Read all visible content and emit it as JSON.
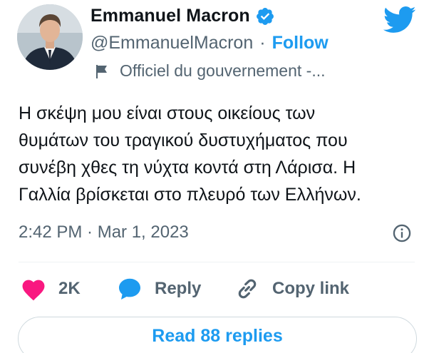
{
  "author": {
    "display_name": "Emmanuel Macron",
    "handle": "@EmmanuelMacron",
    "separator": "·",
    "follow_label": "Follow",
    "label": "Officiel du gouvernement -...",
    "verified_icon": "verified-badge-icon",
    "label_icon": "flag-icon"
  },
  "tweet": {
    "lines": [
      "Η σκέψη μου είναι στους οικείους των",
      "θυμάτων του τραγικού δυστυχήματος που",
      "συνέβη χθες τη νύχτα κοντά στη Λάρισα. Η",
      "Γαλλία βρίσκεται στο πλευρό των Ελλήνων."
    ],
    "timestamp": "2:42 PM · Mar 1, 2023"
  },
  "actions": {
    "like_count": "2K",
    "reply_label": "Reply",
    "copy_link_label": "Copy link"
  },
  "footer": {
    "read_replies_label": "Read 88 replies"
  },
  "colors": {
    "accent": "#1d9bf0",
    "like": "#f91880",
    "secondary_text": "#536471",
    "primary_text": "#0f1419"
  }
}
